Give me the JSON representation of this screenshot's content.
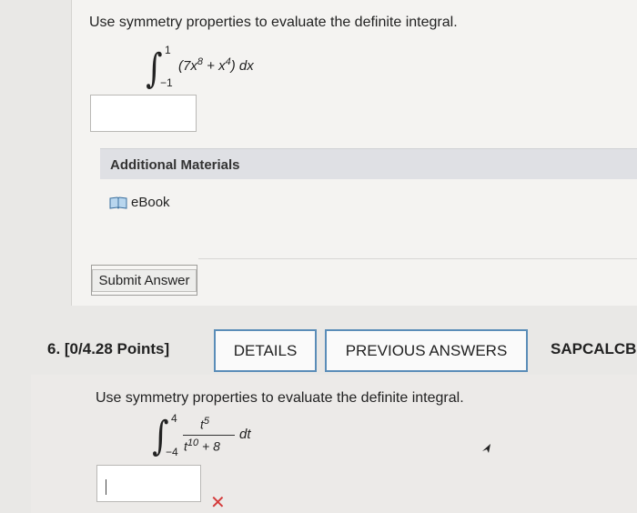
{
  "q5": {
    "prompt": "Use symmetry properties to evaluate the definite integral.",
    "integral": {
      "upper": "1",
      "lower": "−1",
      "integrand_open": "(7x",
      "exp1": "8",
      "mid": " + x",
      "exp2": "4",
      "close": ") dx"
    },
    "answer_value": ""
  },
  "additional_materials": {
    "title": "Additional Materials",
    "ebook_label": "eBook"
  },
  "submit_label": "Submit Answer",
  "q6": {
    "number_points": "6.  [0/4.28 Points]",
    "details_label": "DETAILS",
    "previous_label": "PREVIOUS ANSWERS",
    "course_code": "SAPCALCB",
    "prompt": "Use symmetry properties to evaluate the definite integral.",
    "integral": {
      "upper": "4",
      "lower": "−4",
      "num_base": "t",
      "num_exp": "5",
      "den_base": "t",
      "den_exp": "10",
      "den_rest": " + 8",
      "dvar": "dt"
    },
    "answer_value": "",
    "status": "incorrect",
    "status_glyph": "✕"
  },
  "colors": {
    "button_border": "#5a8db8",
    "incorrect_mark": "#d43b3b",
    "materials_bar": "#dfe0e4"
  },
  "icons": [
    "ebook-icon",
    "incorrect-x-icon",
    "mouse-cursor-icon"
  ]
}
